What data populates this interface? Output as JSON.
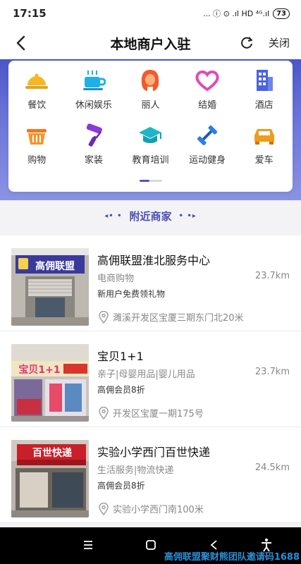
{
  "status_bar": {
    "time": "17:15",
    "indicators": "... ⓘ ⊙ .ıl HD ⁴ᴳ.ıl",
    "battery": "73"
  },
  "nav": {
    "title": "本地商户入驻",
    "close_label": "关闭"
  },
  "categories": [
    {
      "label": "餐饮",
      "icon": "dome-cover-icon",
      "color": "#f5b823"
    },
    {
      "label": "休闲娱乐",
      "icon": "coffee-cup-icon",
      "color": "#1fb0e8"
    },
    {
      "label": "丽人",
      "icon": "woman-icon",
      "color": "#f25a2e"
    },
    {
      "label": "结婚",
      "icon": "heart-icon",
      "color": "#e04bb8"
    },
    {
      "label": "酒店",
      "icon": "building-icon",
      "color": "#4a63e0"
    },
    {
      "label": "购物",
      "icon": "basket-icon",
      "color": "#f07a1e"
    },
    {
      "label": "家装",
      "icon": "paint-roller-icon",
      "color": "#8a3ad8"
    },
    {
      "label": "教育培训",
      "icon": "graduation-cap-icon",
      "color": "#1ab7c8"
    },
    {
      "label": "运动健身",
      "icon": "dumbbell-icon",
      "color": "#2f7de0"
    },
    {
      "label": "爱车",
      "icon": "car-icon",
      "color": "#f29a1e"
    }
  ],
  "section": {
    "title": "附近商家",
    "left_dec": "◂• •",
    "right_dec": "• •▸"
  },
  "merchants": [
    {
      "name": "高佣联盟淮北服务中心",
      "category": "电商购物",
      "distance": "23.7km",
      "promo": "新用户免费领礼物",
      "address": "濉溪开发区宝厦三期东门北20米",
      "sign_text": "高佣联盟"
    },
    {
      "name": "宝贝1+1",
      "category": "亲子|母婴用品|婴儿用品",
      "distance": "23.7km",
      "promo": "高佣会员8折",
      "address": "开发区宝厦一期175号",
      "sign_text": "宝贝1+1"
    },
    {
      "name": "实验小学西门百世快递",
      "category": "生活服务|物流快递",
      "distance": "24.5km",
      "promo": "高佣会员8折",
      "address": "实验小学西门南100米",
      "sign_text": "百世快递"
    }
  ],
  "watermark": "高佣联盟聚财熊团队邀请码1688"
}
